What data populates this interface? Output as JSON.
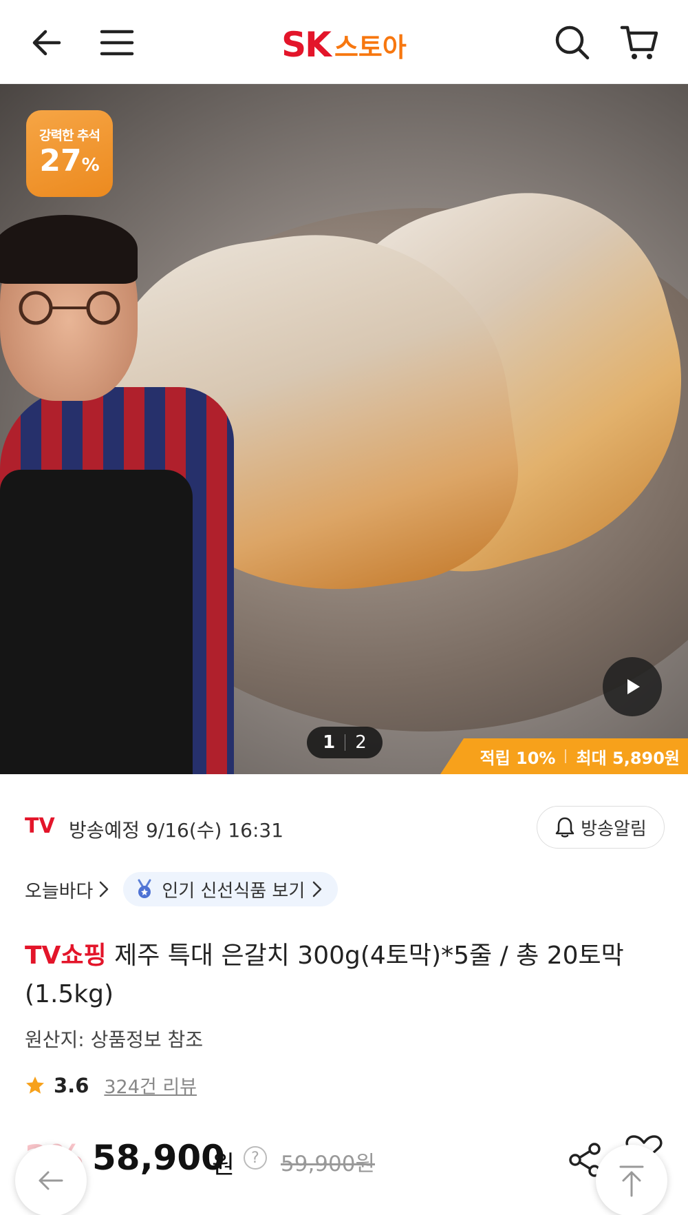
{
  "header": {
    "logo_sk": "SK",
    "logo_store": "스토아"
  },
  "hero": {
    "badge_line1": "강력한 추석",
    "badge_number": "27",
    "badge_percent": "%",
    "pager_current": "1",
    "pager_total": "2",
    "points_rate": "적립 10%",
    "points_max": "최대 5,890원"
  },
  "broadcast": {
    "tag": "TV",
    "schedule": "방송예정 9/16(수) 16:31",
    "alarm_label": "방송알림"
  },
  "category": {
    "link_label": "오늘바다",
    "chip_label": "인기 신선식품 보기"
  },
  "product": {
    "title_prefix": "TV쇼핑",
    "title": "제주 특대 은갈치 300g(4토막)*5줄 / 총 20토막 (1.5kg)",
    "origin": "원산지: 상품정보 참조",
    "rating": "3.6",
    "reviews": "324건 리뷰"
  },
  "price": {
    "discount": "2%",
    "sale_price": "58,900",
    "currency": "원",
    "help": "?",
    "original_price": "59,900원"
  },
  "colors": {
    "brand_red": "#e3152a",
    "brand_orange": "#f7770f",
    "points_bg": "#f7a11b"
  }
}
